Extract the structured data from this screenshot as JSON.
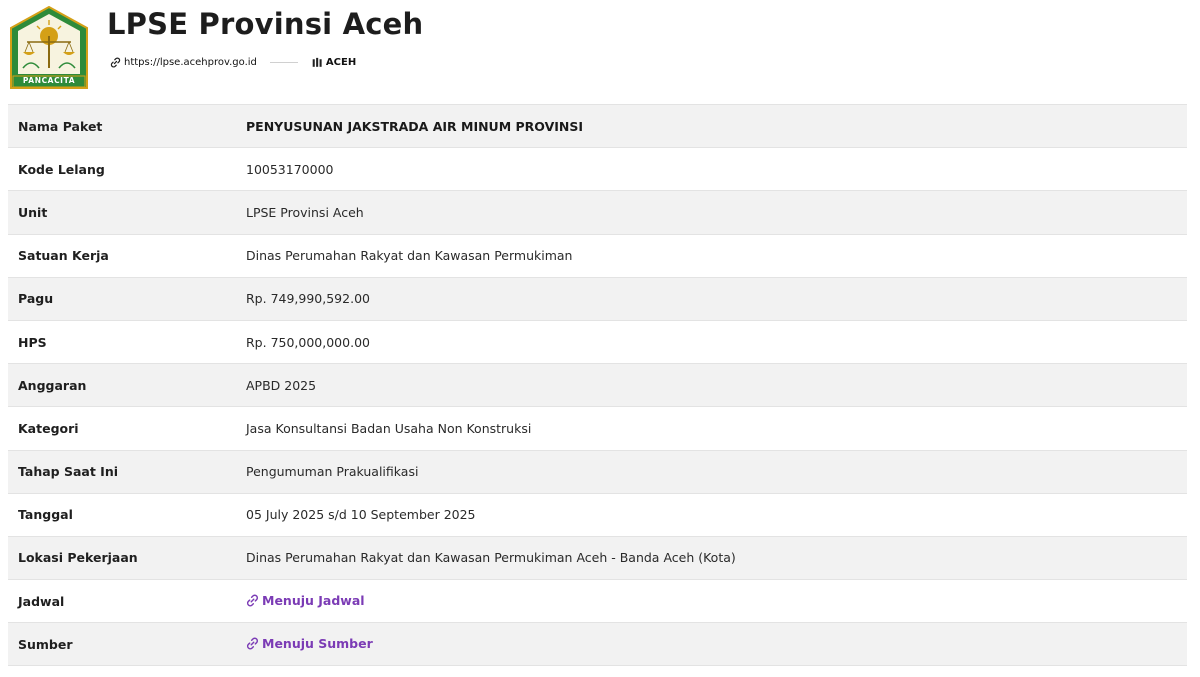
{
  "header": {
    "title": "LPSE Provinsi Aceh",
    "url": "https://lpse.acehprov.go.id",
    "region": "ACEH",
    "logo_caption": "PANCACITA"
  },
  "colors": {
    "logo_green": "#2e8b3a",
    "logo_gold": "#d4a017",
    "link": "#7b3bb5",
    "row_shade": "#f2f2f2"
  },
  "details": [
    {
      "label": "Nama Paket",
      "value": "PENYUSUNAN JAKSTRADA AIR MINUM PROVINSI"
    },
    {
      "label": "Kode Lelang",
      "value": "10053170000"
    },
    {
      "label": "Unit",
      "value": "LPSE Provinsi Aceh"
    },
    {
      "label": "Satuan Kerja",
      "value": "Dinas Perumahan Rakyat dan Kawasan Permukiman"
    },
    {
      "label": "Pagu",
      "value": "Rp. 749,990,592.00"
    },
    {
      "label": "HPS",
      "value": "Rp. 750,000,000.00"
    },
    {
      "label": "Anggaran",
      "value": "APBD 2025"
    },
    {
      "label": "Kategori",
      "value": "Jasa Konsultansi Badan Usaha Non Konstruksi"
    },
    {
      "label": "Tahap Saat Ini",
      "value": "Pengumuman Prakualifikasi"
    },
    {
      "label": "Tanggal",
      "value": "05 July 2025 s/d 10 September 2025"
    },
    {
      "label": "Lokasi Pekerjaan",
      "value": "Dinas Perumahan Rakyat dan Kawasan Permukiman Aceh - Banda Aceh (Kota)"
    },
    {
      "label": "Jadwal",
      "value": "Menuju Jadwal",
      "icon": "link-icon"
    },
    {
      "label": "Sumber",
      "value": "Menuju Sumber",
      "icon": "link-icon"
    }
  ]
}
